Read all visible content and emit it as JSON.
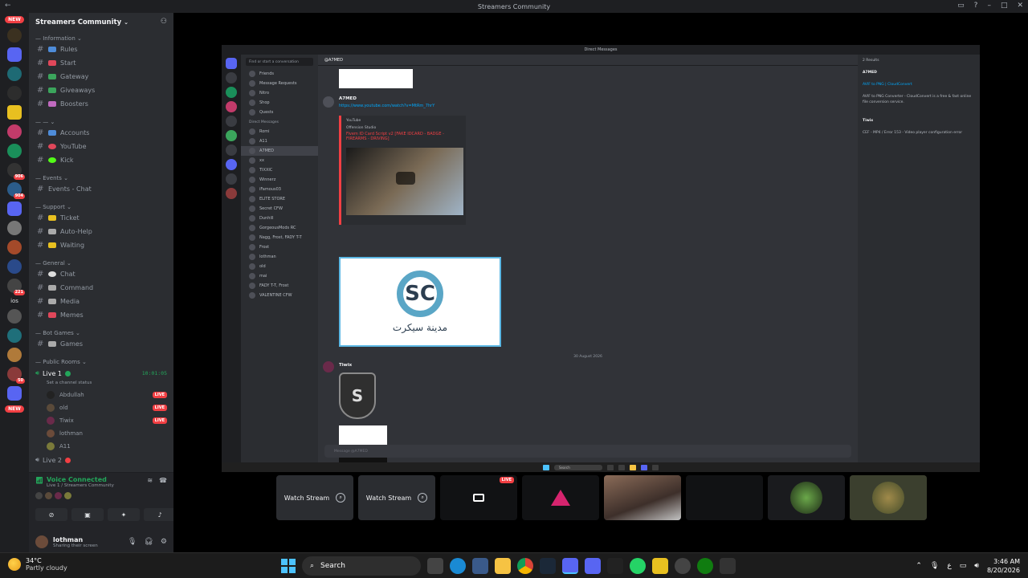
{
  "window": {
    "title": "Streamers Community"
  },
  "rail": {
    "new_badge": "NEW",
    "new_badge_bottom": "NEW",
    "badges": [
      "906",
      "904",
      "221",
      "50"
    ],
    "ios_label": "ios"
  },
  "server": {
    "name": "Streamers Community"
  },
  "categories": {
    "information": "Information",
    "blank": "",
    "events": "Events",
    "support": "Support",
    "general": "General",
    "bot_games": "Bot Games",
    "public_rooms": "Public Rooms"
  },
  "channels": {
    "rules": "Rules",
    "start": "Start",
    "gateway": "Gateway",
    "giveaways": "Giveaways",
    "boosters": "Boosters",
    "accounts": "Accounts",
    "youtube": "YouTube",
    "kick": "Kick",
    "events_chat": "Events - Chat",
    "ticket": "Ticket",
    "auto_help": "Auto-Help",
    "waiting": "Waiting",
    "chat": "Chat",
    "command": "Command",
    "media": "Media",
    "memes": "Memes",
    "games": "Games"
  },
  "voice": {
    "live1_name": "Live 1",
    "live1_timer": "10:01:05",
    "live1_status_placeholder": "Set a channel status",
    "live2_name": "Live 2",
    "live_badge": "LIVE",
    "users": [
      {
        "name": "Abdullah",
        "live": true
      },
      {
        "name": "old",
        "live": true
      },
      {
        "name": "Tiwix",
        "live": true
      },
      {
        "name": "lothman",
        "live": false
      },
      {
        "name": "A11",
        "live": false
      }
    ]
  },
  "voice_panel": {
    "title": "Voice Connected",
    "subtitle": "Live 1 / Streamers Community"
  },
  "user_panel": {
    "name": "lothman",
    "status": "Sharing their screen"
  },
  "stream": {
    "inner_title": "Direct Messages",
    "search_placeholder": "Find or start a conversation",
    "dm_items": [
      "Friends",
      "Message Requests",
      "Nitro",
      "Shop",
      "Quests",
      "Direct Messages",
      "Romi",
      "A11",
      "A7MED",
      "xx",
      "TIXXIC",
      "Winnerz",
      "iFamous03",
      "ELITE STORE",
      "Secret CFW",
      "Dunhill",
      "GorgeousMods RC",
      "Nagg, Frost, FADY T-T",
      "Frost",
      "lothman",
      "old",
      "mai",
      "FADY T-T, Frost",
      "VALENTINE CFW"
    ],
    "header_user": "A7MED",
    "msg1_user": "A7MED",
    "msg1_link": "https://www.youtube.com/watch?v=MtRm_7hrY",
    "embed_source": "YouTube",
    "embed_channel": "Offension Studio",
    "embed_title": "Fivem ID Card Script v2 [FAKE IDCARD - BADGE - FIREARMS - DRIVING]",
    "sc_arabic": "مدينة سيكرت",
    "sc_letters": "SC",
    "date_separator": "30 August 2026",
    "msg2_user": "Tiwix",
    "shield_letter": "S",
    "composer_placeholder": "Message @A7MED",
    "results_count": "2 Results",
    "results_user": "A7MED",
    "results_link_title": "AVIF to PNG | CloudConvert",
    "results_desc": "AVIF to PNG Converter - CloudConvert is a free & fast online file conversion service.",
    "results_user2": "Tiwix",
    "results_code": "CEF - MP4 / Error 153 - Video player configuration error",
    "taskbar_search": "Search"
  },
  "tiles": {
    "watch_stream": "Watch Stream",
    "live_badge": "LIVE"
  },
  "taskbar": {
    "temp": "34°C",
    "weather": "Partly cloudy",
    "search": "Search",
    "lang": "ع",
    "time": "3:46 AM",
    "date": "8/20/2026"
  }
}
